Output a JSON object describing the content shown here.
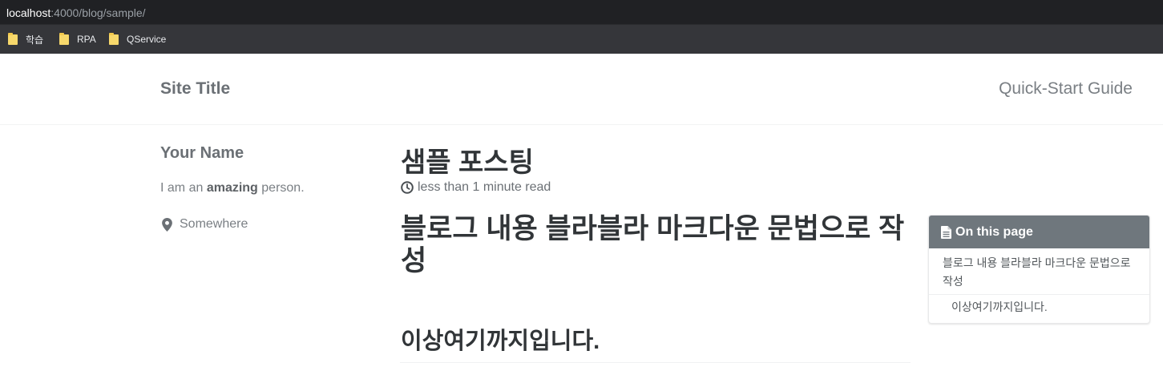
{
  "browser": {
    "url_host": "localhost",
    "url_path": ":4000/blog/sample/",
    "bookmarks": [
      {
        "label": "학습"
      },
      {
        "label": "RPA"
      },
      {
        "label": "QService"
      }
    ]
  },
  "masthead": {
    "site_title": "Site Title",
    "nav_link": "Quick-Start Guide"
  },
  "author": {
    "name": "Your Name",
    "bio_prefix": "I am an ",
    "bio_bold": "amazing",
    "bio_suffix": " person.",
    "location": "Somewhere"
  },
  "post": {
    "title": "샘플 포스팅",
    "read_time": "less than 1 minute read",
    "heading1": "블로그 내용 블라블라 마크다운 문법으로 작성",
    "heading2": "이상여기까지입니다."
  },
  "toc": {
    "title": "On this page",
    "items": [
      {
        "label": "블로그 내용 블라블라 마크다운 문법으로 작성"
      },
      {
        "label": "이상여기까지입니다."
      }
    ]
  }
}
